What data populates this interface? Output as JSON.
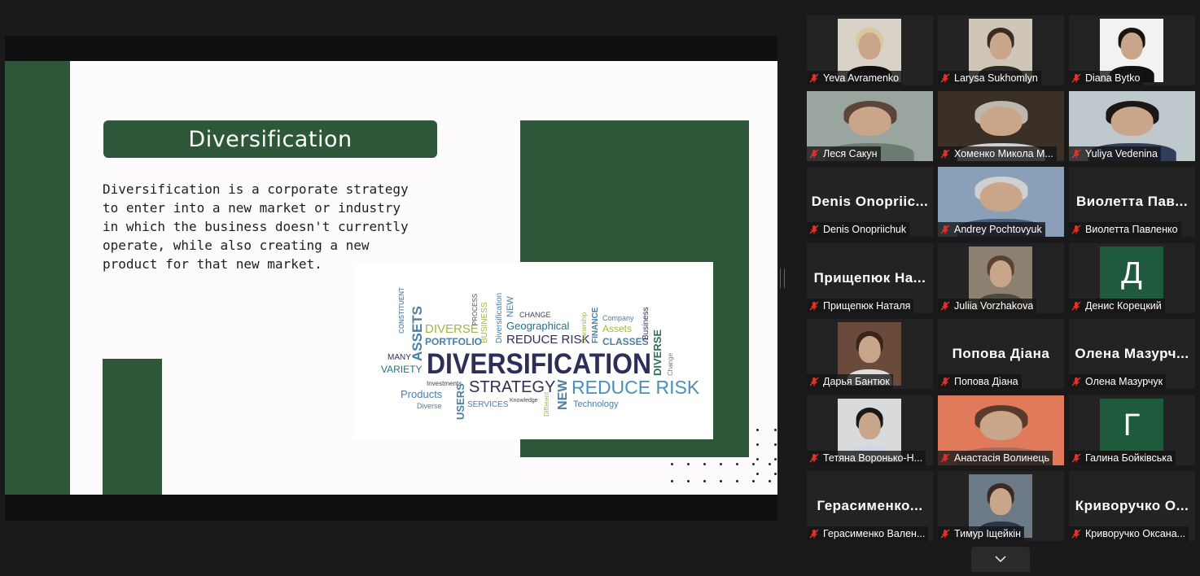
{
  "slide": {
    "title": "Diversification",
    "body": "Diversification is a corporate strategy\nto enter into a new market or industry\nin which the business doesn't currently\noperate, while also creating a new\nproduct for that new market.",
    "wordcloud": {
      "main": "DIVERSIFICATION",
      "words": [
        "CONSTITUENT",
        "ASSETS",
        "DIVERSE",
        "PORTFOLIO",
        "PROCESS",
        "BUSINESS",
        "Diversification",
        "NEW",
        "CHANGE",
        "Geographical",
        "REDUCE RISK",
        "Ownership",
        "FINANCE",
        "Company",
        "Assets",
        "CLASSES",
        "Business",
        "DIVERSE",
        "Change",
        "MANY",
        "VARIETY",
        "Investments",
        "Products",
        "Diverse",
        "USERS",
        "STRATEGY",
        "SERVICES",
        "Knowledge",
        "Different",
        "NEW",
        "REDUCE RISK",
        "Technology"
      ]
    }
  },
  "participants": [
    {
      "name": "Yeva Avramenko",
      "type": "video"
    },
    {
      "name": "Larysa Sukhomlyn",
      "type": "video"
    },
    {
      "name": "Diana Bytko",
      "type": "video"
    },
    {
      "name": "Леся Сакун",
      "type": "video"
    },
    {
      "name": "Хоменко Микола М...",
      "type": "video"
    },
    {
      "name": "Yuliya Vedenina",
      "type": "video"
    },
    {
      "name": "Denis Onopriichuk",
      "display": "Denis Onopriic...",
      "type": "name"
    },
    {
      "name": "Andrey Pochtovyuk",
      "type": "video"
    },
    {
      "name": "Виолетта Павленко",
      "display": "Виолетта Пав...",
      "type": "name"
    },
    {
      "name": "Прищепюк Наталя",
      "display": "Прищепюк На...",
      "type": "name"
    },
    {
      "name": "Juliia Vorzhakova",
      "type": "video"
    },
    {
      "name": "Денис Корецкий",
      "initial": "Д",
      "type": "initial"
    },
    {
      "name": "Дарья Бантюк",
      "type": "video"
    },
    {
      "name": "Попова Діана",
      "display": "Попова Діана",
      "type": "name"
    },
    {
      "name": "Олена Мазурчук",
      "display": "Олена Мазурч...",
      "type": "name"
    },
    {
      "name": "Тетяна Воронько-Н...",
      "type": "video"
    },
    {
      "name": "Анастасія Волинець",
      "type": "video",
      "active": true
    },
    {
      "name": "Галина Бойківська",
      "initial": "Г",
      "type": "initial"
    },
    {
      "name": "Герасименко Вален...",
      "display": "Герасименко...",
      "type": "name"
    },
    {
      "name": "Тимур Іщейкін",
      "type": "video"
    },
    {
      "name": "Криворучко Оксана...",
      "display": "Криворучко О...",
      "type": "name"
    }
  ],
  "colors": {
    "slide_green": "#2d5738",
    "active_border": "#c6e04a",
    "muted_mic": "#e0302a",
    "initial_bg": "#1f5a3c"
  },
  "icons": {
    "mic": "muted-mic-icon",
    "expand": "chevron-down-icon"
  }
}
